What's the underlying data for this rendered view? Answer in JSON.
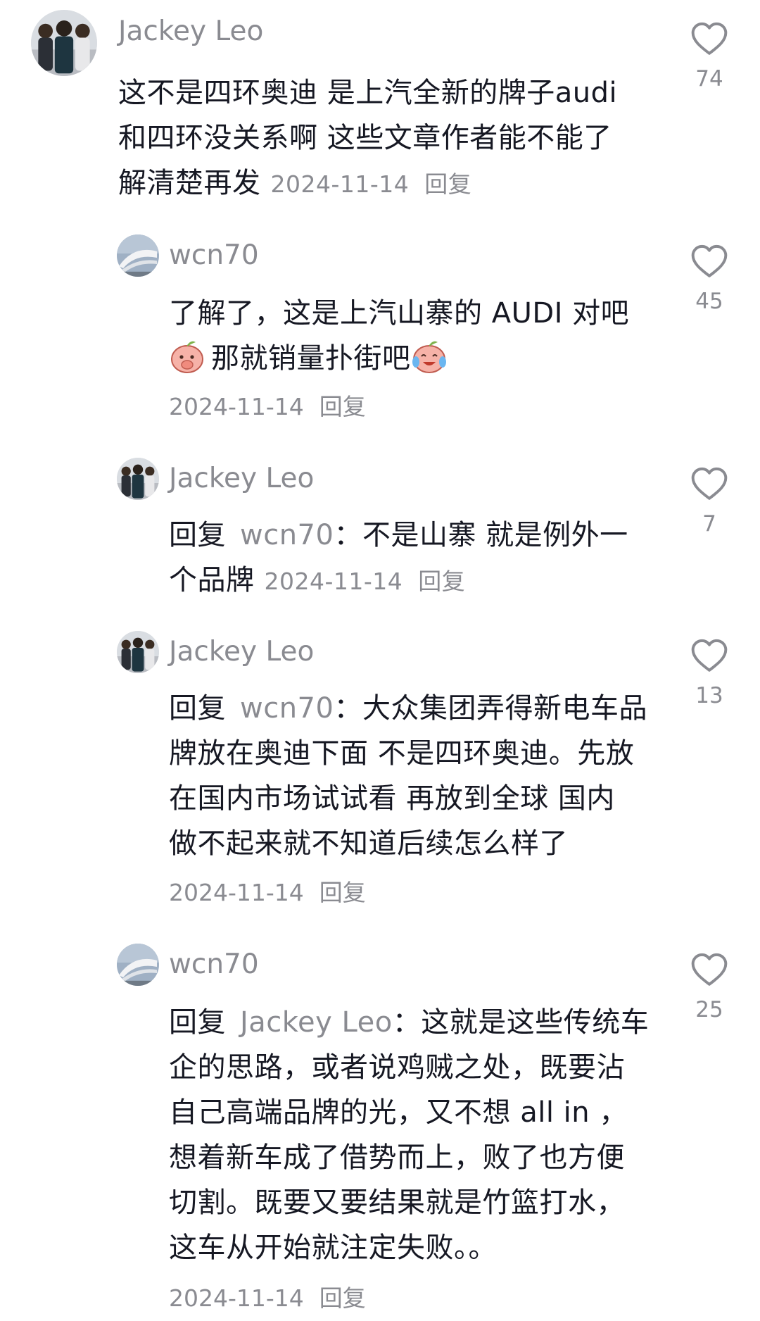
{
  "comments": [
    {
      "author": "Jackey Leo",
      "avatar_icon": "group-photo-avatar",
      "lines": [
        "这不是四环奥迪 是上汽全新的牌子audi",
        "和四环没关系啊 这些文章作者能不能了",
        "解清楚再发"
      ],
      "date": "2024-11-14",
      "reply_label": "回复",
      "likes": "74"
    },
    {
      "author": "wcn70",
      "avatar_icon": "architecture-photo-avatar",
      "lines": [
        "了解了，这是上汽山寨的 AUDI 对吧",
        "那就销量扑街吧"
      ],
      "date": "2024-11-14",
      "reply_label": "回复",
      "likes": "45"
    },
    {
      "author": "Jackey Leo",
      "avatar_icon": "group-photo-avatar",
      "reply_prefix": "回复",
      "reply_target": "wcn70",
      "lines": [
        "：不是山寨 就是例外一",
        "个品牌"
      ],
      "date": "2024-11-14",
      "reply_label": "回复",
      "likes": "7"
    },
    {
      "author": "Jackey Leo",
      "avatar_icon": "group-photo-avatar",
      "reply_prefix": "回复",
      "reply_target": "wcn70",
      "lines": [
        "：大众集团弄得新电车品",
        "牌放在奥迪下面 不是四环奥迪。先放",
        "在国内市场试试看 再放到全球 国内",
        "做不起来就不知道后续怎么样了"
      ],
      "date": "2024-11-14",
      "reply_label": "回复",
      "likes": "13"
    },
    {
      "author": "wcn70",
      "avatar_icon": "architecture-photo-avatar",
      "reply_prefix": "回复",
      "reply_target": "Jackey Leo",
      "lines": [
        "：这就是这些传统车",
        "企的思路，或者说鸡贼之处，既要沾",
        "自己高端品牌的光，又不想 all in ，",
        "想着新车成了借势而上，败了也方便",
        "切割。既要又要结果就是竹篮打水，",
        "这车从开始就注定失败。。"
      ],
      "date": "2024-11-14",
      "reply_label": "回复",
      "likes": "25"
    }
  ],
  "icons": {
    "like": "heart-outline-icon",
    "emoji_1": "peach-face-covering-mouth-emoji",
    "emoji_2": "peach-face-crying-laughing-emoji"
  },
  "colors": {
    "text": "#161823",
    "secondary": "#8a8b91",
    "icon": "#8a8b91",
    "background": "#ffffff"
  }
}
